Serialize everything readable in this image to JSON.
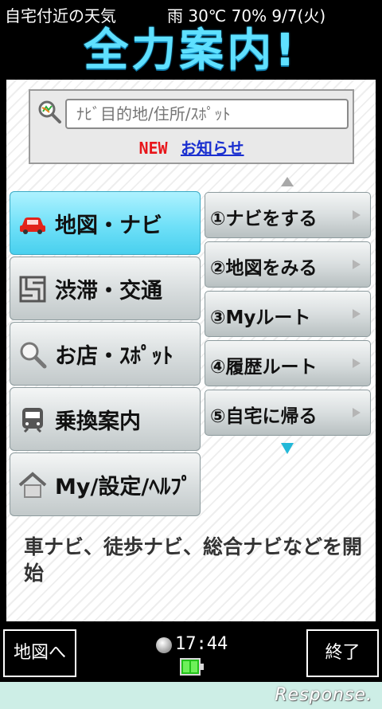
{
  "header": {
    "weather_location": "自宅付近の天気",
    "weather_condition": "雨 30℃ 70% 9/7(火)",
    "app_title": "全力案内!"
  },
  "search": {
    "placeholder": "ﾅﾋﾞ目的地/住所/ｽﾎﾟｯﾄ",
    "value": "",
    "new_badge": "NEW",
    "notice_link": "お知らせ"
  },
  "categories": [
    {
      "label": "地図・ナビ",
      "icon": "car-icon",
      "active": true
    },
    {
      "label": "渋滞・交通",
      "icon": "traffic-icon",
      "active": false
    },
    {
      "label": "お店・ｽﾎﾟｯﾄ",
      "icon": "magnifier-icon",
      "active": false
    },
    {
      "label": "乗換案内",
      "icon": "train-icon",
      "active": false
    },
    {
      "label": "My/設定/ﾍﾙﾌﾟ",
      "icon": "home-icon",
      "active": false
    }
  ],
  "sub_menu": [
    {
      "label": "①ナビをする"
    },
    {
      "label": "②地図をみる"
    },
    {
      "label": "③Myルート"
    },
    {
      "label": "④履歴ルート"
    },
    {
      "label": "⑤自宅に帰る"
    }
  ],
  "description": "車ナビ、徒歩ナビ、総合ナビなどを開始",
  "bottom_bar": {
    "left_button": "地図へ",
    "right_button": "終了",
    "clock": "17:44"
  },
  "watermark": "Response.",
  "colors": {
    "active_category": "#6fe0f8",
    "title": "#5fe0ff",
    "new_badge": "#e8161b",
    "link": "#1a2fd0"
  }
}
